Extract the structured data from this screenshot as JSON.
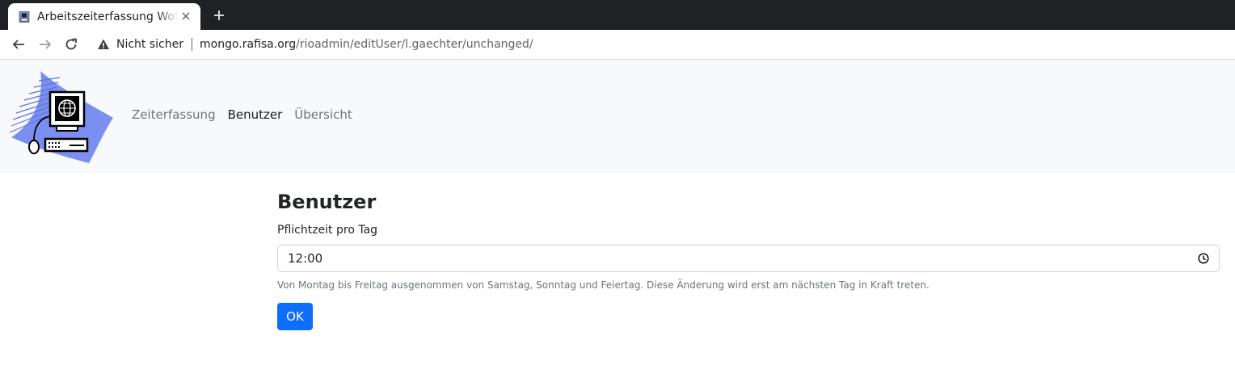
{
  "browser": {
    "tab_title": "Arbeitszeiterfassung Wolf",
    "security_label": "Nicht sicher",
    "url_host": "mongo.rafisa.org",
    "url_path": "/rioadmin/editUser/l.gaechter/unchanged/",
    "icons": {
      "favicon": "computer-favicon",
      "close": "close-icon",
      "new_tab": "plus-icon",
      "back": "back-arrow-icon",
      "forward": "forward-arrow-icon",
      "reload": "reload-icon",
      "warning": "warning-triangle-icon"
    }
  },
  "navbar": {
    "logo": "computer-globe-logo",
    "links": [
      {
        "label": "Zeiterfassung",
        "active": false
      },
      {
        "label": "Benutzer",
        "active": true
      },
      {
        "label": "Übersicht",
        "active": false
      }
    ]
  },
  "form": {
    "heading": "Benutzer",
    "field_label": "Pflichtzeit pro Tag",
    "time_value": "12:00",
    "help_text": "Von Montag bis Freitag ausgenommen von Samstag, Sonntag und Feiertag. Diese Änderung wird erst am nächsten Tag in Kraft treten.",
    "submit_label": "OK"
  },
  "colors": {
    "primary": "#0d6efd",
    "navbar_bg": "#f8f9fa",
    "chrome_dark": "#202124"
  }
}
